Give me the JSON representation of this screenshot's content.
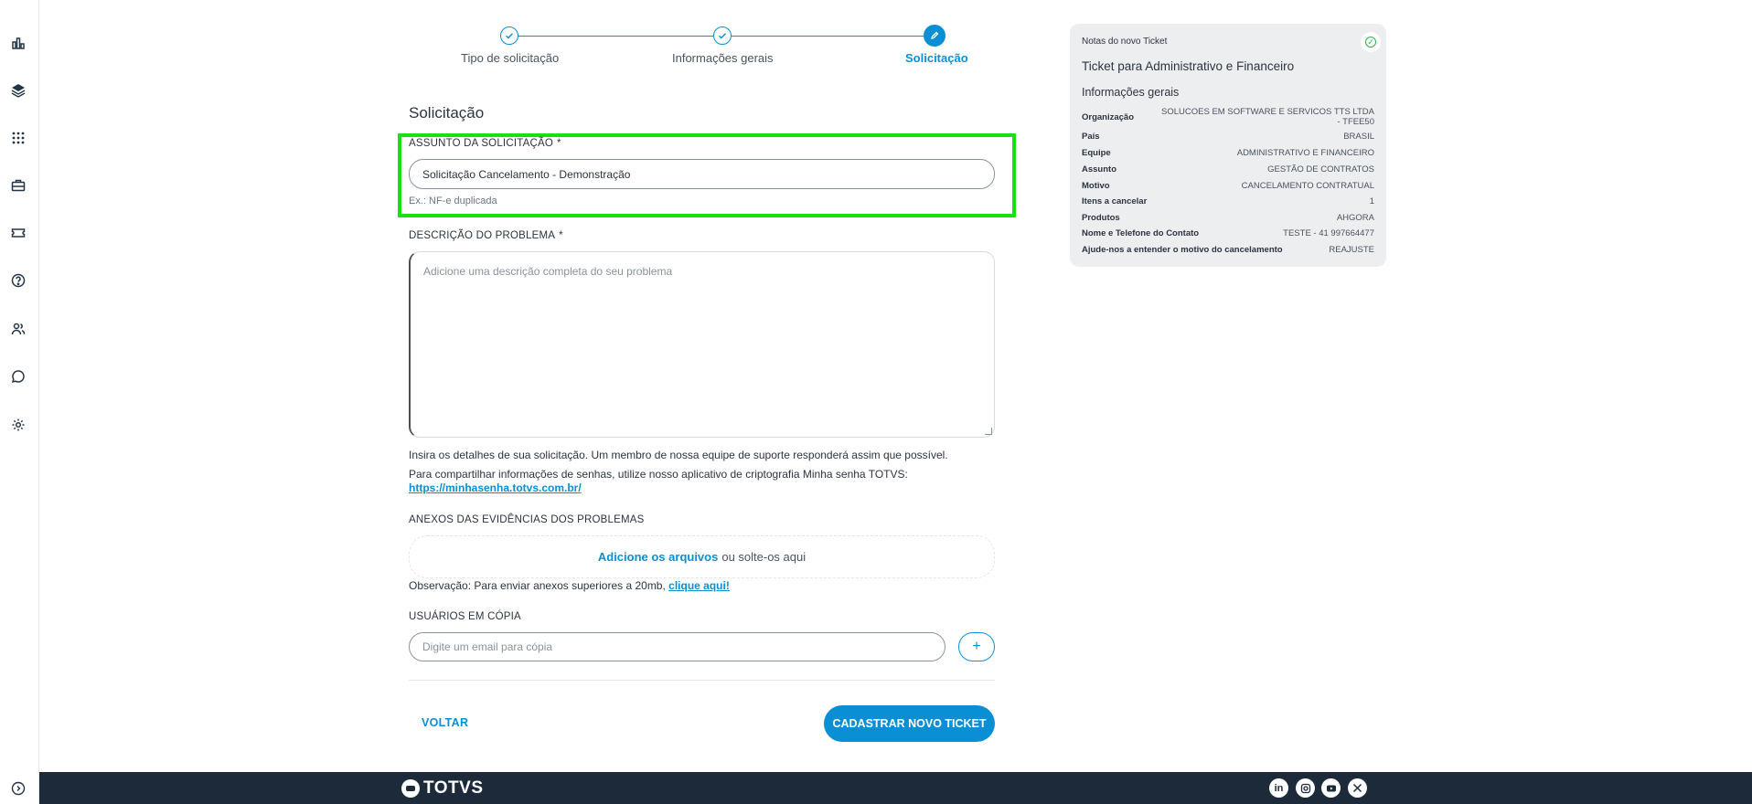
{
  "sidebar": {
    "icons": [
      "chart-icon",
      "layers-icon",
      "apps-grid-icon",
      "briefcase-icon",
      "ticket-icon",
      "help-icon",
      "users-icon",
      "chat-icon",
      "gear-icon",
      "expand-icon"
    ]
  },
  "stepper": {
    "steps": [
      {
        "label": "Tipo de solicitação",
        "state": "done"
      },
      {
        "label": "Informações gerais",
        "state": "done"
      },
      {
        "label": "Solicitação",
        "state": "active"
      }
    ]
  },
  "form": {
    "section_title": "Solicitação",
    "subject_label": "ASSUNTO DA SOLICITAÇÃO",
    "required_mark": "*",
    "subject_value": "Solicitação Cancelamento - Demonstração",
    "subject_hint": "Ex.: NF-e duplicada",
    "description_label": "DESCRIÇÃO DO PROBLEMA",
    "description_placeholder": "Adicione uma descrição completa do seu problema",
    "info_text": "Insira os detalhes de sua solicitação. Um membro de nossa equipe de suporte responderá assim que possível.",
    "password_text": "Para compartilhar informações de senhas, utilize nosso aplicativo de criptografia Minha senha TOTVS:",
    "password_link": "https://minhasenha.totvs.com.br/",
    "attachments_label": "ANEXOS DAS EVIDÊNCIAS DOS PROBLEMAS",
    "dropzone_link": "Adicione os arquivos",
    "dropzone_text": "ou solte-os aqui",
    "observation_text": "Observação: Para enviar anexos superiores a 20mb,",
    "observation_link": "clique aqui!",
    "cc_label": "USUÁRIOS EM CÓPIA",
    "cc_placeholder": "Digite um email para cópia",
    "cc_add": "+",
    "back_label": "VOLTAR",
    "submit_label": "CADASTRAR NOVO TICKET"
  },
  "notes": {
    "header": "Notas do novo Ticket",
    "title": "Ticket para Administrativo e Financeiro",
    "subtitle": "Informações gerais",
    "rows": [
      {
        "key": "Organização",
        "value": "SOLUCOES EM SOFTWARE E SERVICOS TTS LTDA - TFEE50"
      },
      {
        "key": "País",
        "value": "BRASIL"
      },
      {
        "key": "Equipe",
        "value": "ADMINISTRATIVO E FINANCEIRO"
      },
      {
        "key": "Assunto",
        "value": "GESTÃO DE CONTRATOS"
      },
      {
        "key": "Motivo",
        "value": "CANCELAMENTO CONTRATUAL"
      },
      {
        "key": "Itens a cancelar",
        "value": "1"
      },
      {
        "key": "Produtos",
        "value": "AHGORA"
      },
      {
        "key": "Nome e Telefone do Contato",
        "value": "TESTE - 41 997664477"
      },
      {
        "key": "Ajude-nos a entender o motivo do cancelamento",
        "value": "REAJUSTE"
      }
    ]
  },
  "footer": {
    "brand": "TOTVS",
    "social": [
      "linkedin-icon",
      "instagram-icon",
      "youtube-icon",
      "x-icon"
    ]
  },
  "colors": {
    "accent": "#0b8fd4",
    "highlight": "#17e20f",
    "footer": "#1d2a3a"
  }
}
